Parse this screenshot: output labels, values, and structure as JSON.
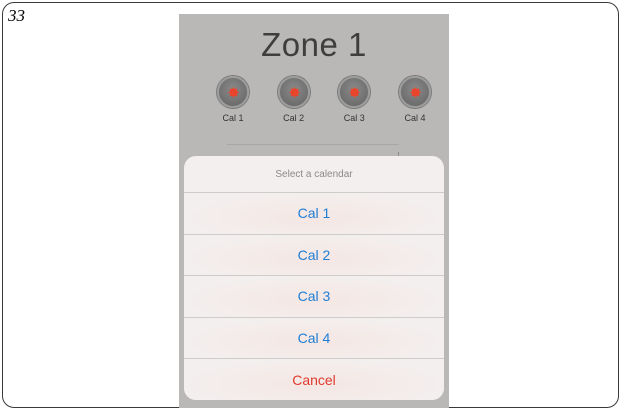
{
  "page": {
    "number": "33"
  },
  "screen": {
    "title": "Zone 1",
    "calendars": [
      {
        "label": "Cal 1",
        "icon": "gear-icon"
      },
      {
        "label": "Cal 2",
        "icon": "gear-icon"
      },
      {
        "label": "Cal 3",
        "icon": "gear-icon"
      },
      {
        "label": "Cal 4",
        "icon": "gear-icon"
      }
    ]
  },
  "action_sheet": {
    "header": "Select a calendar",
    "options": [
      {
        "label": "Cal 1"
      },
      {
        "label": "Cal 2"
      },
      {
        "label": "Cal 3"
      },
      {
        "label": "Cal 4"
      }
    ],
    "cancel_label": "Cancel"
  },
  "colors": {
    "option_text": "#1e7ed6",
    "cancel_text": "#e03a2e",
    "gear": "#e8452c",
    "background_dim": "#bab8b6"
  }
}
